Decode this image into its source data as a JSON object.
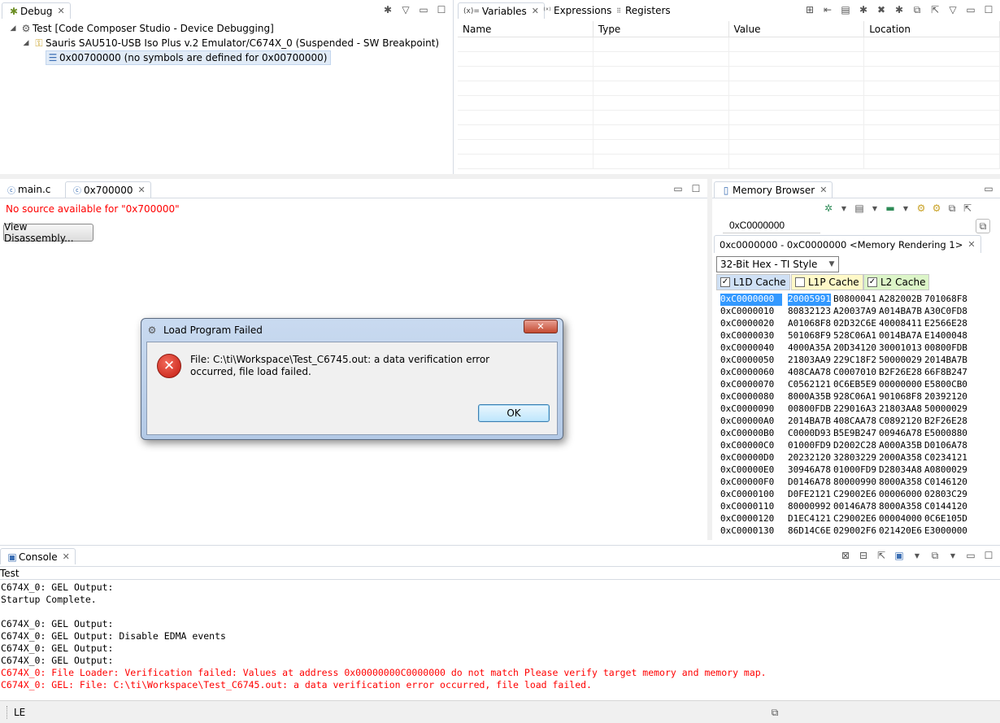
{
  "debug": {
    "tab_label": "Debug",
    "tree": [
      {
        "label": "Test [Code Composer Studio - Device Debugging]"
      },
      {
        "label": "Sauris SAU510-USB Iso Plus v.2 Emulator/C674X_0 (Suspended - SW Breakpoint)"
      },
      {
        "label": "0x00700000  (no symbols are defined for 0x00700000)"
      }
    ]
  },
  "variables": {
    "tabs": [
      "Variables",
      "Expressions",
      "Registers"
    ],
    "tab_prefix": "(x)=",
    "columns": [
      "Name",
      "Type",
      "Value",
      "Location"
    ]
  },
  "editor": {
    "tabs": [
      "main.c",
      "0x700000"
    ],
    "no_source_msg": "No source available for \"0x700000\"",
    "view_disassembly": "View Disassembly..."
  },
  "memory": {
    "tab_label": "Memory Browser",
    "address_input": "0xC0000000",
    "rendering_tab": "0xc0000000 - 0xC0000000 <Memory Rendering 1>",
    "format": "32-Bit Hex - TI Style",
    "l1d": "L1D Cache",
    "l1p": "L1P Cache",
    "l2": "L2 Cache",
    "rows": [
      {
        "addr": "0xC0000000",
        "w1": "20005991",
        "w2": "B0800041",
        "w3": "A282002B",
        "w4": "701068F8"
      },
      {
        "addr": "0xC0000010",
        "w1": "80832123",
        "w2": "A20037A9",
        "w3": "A014BA7B",
        "w4": "A30C0FD8"
      },
      {
        "addr": "0xC0000020",
        "w1": "A01068F8",
        "w2": "02D32C6E",
        "w3": "40008411",
        "w4": "E2566E28"
      },
      {
        "addr": "0xC0000030",
        "w1": "501068F9",
        "w2": "528C06A1",
        "w3": "0014BA7A",
        "w4": "E1400048"
      },
      {
        "addr": "0xC0000040",
        "w1": "4000A35A",
        "w2": "20D34120",
        "w3": "30001013",
        "w4": "00800FDB"
      },
      {
        "addr": "0xC0000050",
        "w1": "21803AA9",
        "w2": "229C18F2",
        "w3": "50000029",
        "w4": "2014BA7B"
      },
      {
        "addr": "0xC0000060",
        "w1": "408CAA78",
        "w2": "C0007010",
        "w3": "B2F26E28",
        "w4": "66F8B247"
      },
      {
        "addr": "0xC0000070",
        "w1": "C0562121",
        "w2": "0C6EB5E9",
        "w3": "00000000",
        "w4": "E5800CB0"
      },
      {
        "addr": "0xC0000080",
        "w1": "8000A35B",
        "w2": "928C06A1",
        "w3": "901068F8",
        "w4": "20392120"
      },
      {
        "addr": "0xC0000090",
        "w1": "00800FDB",
        "w2": "229016A3",
        "w3": "21803AA8",
        "w4": "50000029"
      },
      {
        "addr": "0xC00000A0",
        "w1": "2014BA7B",
        "w2": "408CAA78",
        "w3": "C0892120",
        "w4": "B2F26E28"
      },
      {
        "addr": "0xC00000B0",
        "w1": "C0000D93",
        "w2": "B5E9B247",
        "w3": "00946A78",
        "w4": "E5000880"
      },
      {
        "addr": "0xC00000C0",
        "w1": "01000FD9",
        "w2": "D2002C28",
        "w3": "A000A35B",
        "w4": "D0106A78"
      },
      {
        "addr": "0xC00000D0",
        "w1": "20232120",
        "w2": "32803229",
        "w3": "2000A358",
        "w4": "C0234121"
      },
      {
        "addr": "0xC00000E0",
        "w1": "30946A78",
        "w2": "01000FD9",
        "w3": "D28034A8",
        "w4": "A0800029"
      },
      {
        "addr": "0xC00000F0",
        "w1": "D0146A78",
        "w2": "80000990",
        "w3": "8000A358",
        "w4": "C0146120"
      },
      {
        "addr": "0xC0000100",
        "w1": "D0FE2121",
        "w2": "C29002E6",
        "w3": "00006000",
        "w4": "02803C29"
      },
      {
        "addr": "0xC0000110",
        "w1": "80000992",
        "w2": "00146A78",
        "w3": "8000A358",
        "w4": "C0144120"
      },
      {
        "addr": "0xC0000120",
        "w1": "D1EC4121",
        "w2": "C29002E6",
        "w3": "00004000",
        "w4": "0C6E105D"
      },
      {
        "addr": "0xC0000130",
        "w1": "86D14C6E",
        "w2": "029002F6",
        "w3": "021420E6",
        "w4": "E3000000"
      }
    ]
  },
  "dialog": {
    "title": "Load Program Failed",
    "message": "File: C:\\ti\\Workspace\\Test_C6745.out: a data verification error occurred, file load failed.",
    "ok": "OK"
  },
  "console": {
    "tab_label": "Console",
    "subtitle": "Test",
    "lines": [
      {
        "text": "C674X_0: GEL Output:",
        "error": false
      },
      {
        "text": "Startup Complete.",
        "error": false
      },
      {
        "text": "",
        "error": false
      },
      {
        "text": "C674X_0: GEL Output:",
        "error": false
      },
      {
        "text": "C674X_0: GEL Output: Disable EDMA events",
        "error": false
      },
      {
        "text": "C674X_0: GEL Output:",
        "error": false
      },
      {
        "text": "C674X_0: GEL Output:",
        "error": false
      },
      {
        "text": "C674X_0: File Loader: Verification failed: Values at address 0x00000000C0000000 do not match Please verify target memory and memory map.",
        "error": true
      },
      {
        "text": "C674X_0: GEL: File: C:\\ti\\Workspace\\Test_C6745.out: a data verification error occurred, file load failed.",
        "error": true
      }
    ]
  },
  "status": {
    "endian": "LE"
  },
  "colors": {
    "error_text": "#ff0000",
    "selection": "#3399ff",
    "accent": "#3c6fb4"
  }
}
